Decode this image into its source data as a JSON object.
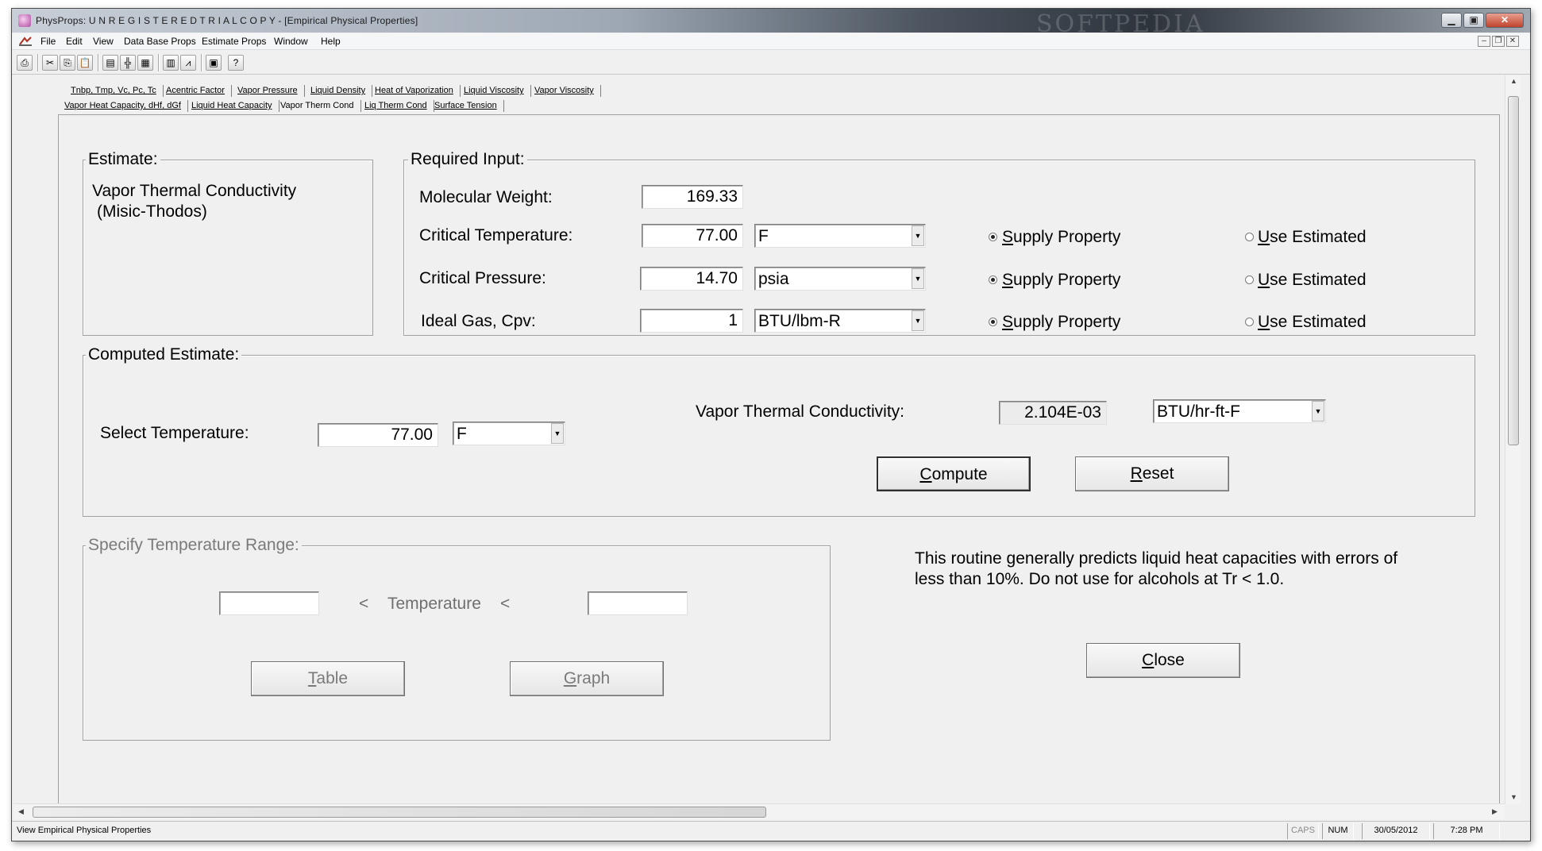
{
  "window": {
    "title": "PhysProps: U N R E G I S T E R E D  T R I A L  C O P Y - [Empirical Physical Properties]",
    "watermark": "SOFTPEDIA"
  },
  "menu": [
    "File",
    "Edit",
    "View",
    "Data Base Props",
    "Estimate Props",
    "Window",
    "Help"
  ],
  "tabs_row1": [
    "Tnbp, Tmp, Vc, Pc, Tc",
    "Acentric Factor",
    "Vapor Pressure",
    "Liquid Density",
    "Heat of Vaporization",
    "Liquid Viscosity",
    "Vapor Viscosity"
  ],
  "tabs_row2": [
    "Vapor Heat Capacity, dHf, dGf",
    "Liquid Heat Capacity",
    "Vapor Therm Cond",
    "Liq Therm Cond",
    "Surface Tension"
  ],
  "estimate": {
    "legend": "Estimate:",
    "method_line1": "Vapor Thermal Conductivity",
    "method_line2": "(Misic-Thodos)"
  },
  "required": {
    "legend": "Required Input:",
    "mw_label": "Molecular Weight:",
    "mw_value": "169.33",
    "tc_label": "Critical Temperature:",
    "tc_value": "77.00",
    "tc_unit": "F",
    "pc_label": "Critical Pressure:",
    "pc_value": "14.70",
    "pc_unit": "psia",
    "cpv_label": "Ideal Gas, Cpv:",
    "cpv_value": "1",
    "cpv_unit": "BTU/lbm-R",
    "supply": "upply Property",
    "supply_key": "S",
    "use": "se Estimated",
    "use_key": "U"
  },
  "computed": {
    "legend": "Computed Estimate:",
    "temp_label": "Select Temperature:",
    "temp_value": "77.00",
    "temp_unit": "F",
    "result_label": "Vapor Thermal Conductivity:",
    "result_value": "2.104E-03",
    "result_unit": "BTU/hr-ft-F",
    "compute_key": "C",
    "compute_rest": "ompute",
    "reset_key": "R",
    "reset_rest": "eset"
  },
  "range": {
    "legend": "Specify Temperature Range:",
    "lt": "<",
    "temp_label": "Temperature",
    "table_key": "T",
    "table_rest": "able",
    "graph_key": "G",
    "graph_rest": "raph"
  },
  "note": {
    "line1": "This routine generally predicts liquid heat capacities with errors of",
    "line2": "less than 10%.  Do not use for alcohols at Tr < 1.0."
  },
  "close_key": "C",
  "close_rest": "lose",
  "status": {
    "text": "View Empirical Physical Properties",
    "caps": "CAPS",
    "num": "NUM",
    "date": "30/05/2012",
    "time": "7:28 PM"
  }
}
